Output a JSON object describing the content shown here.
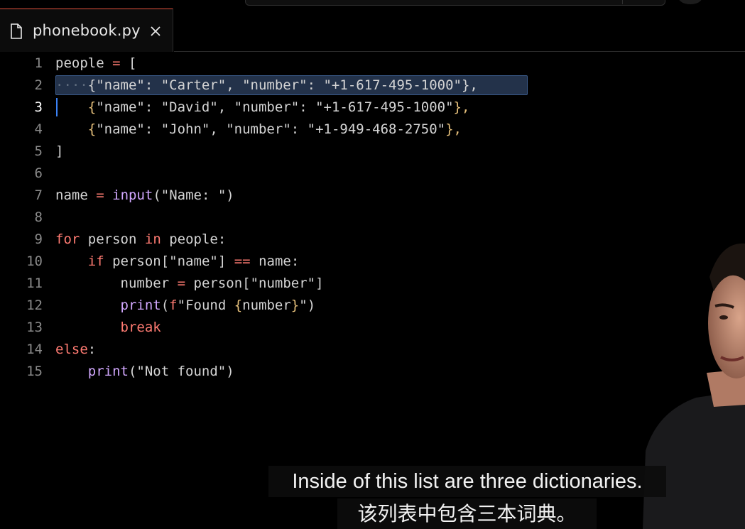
{
  "tab": {
    "filename": "phonebook.py",
    "file_icon": "file-icon",
    "close_icon": "close-icon"
  },
  "editor": {
    "active_line": 3,
    "lines": [
      {
        "num": "1"
      },
      {
        "num": "2"
      },
      {
        "num": "3"
      },
      {
        "num": "4"
      },
      {
        "num": "5"
      },
      {
        "num": "6"
      },
      {
        "num": "7"
      },
      {
        "num": "8"
      },
      {
        "num": "9"
      },
      {
        "num": "10"
      },
      {
        "num": "11"
      },
      {
        "num": "12"
      },
      {
        "num": "13"
      },
      {
        "num": "14"
      },
      {
        "num": "15"
      }
    ],
    "code": {
      "l1_var": "people",
      "l1_op": "=",
      "l1_bracket": "[",
      "l2_text": "{\"name\": \"Carter\", \"number\": \"+1-617-495-1000\"},",
      "l3_open": "{",
      "l3_text": "\"name\": \"David\", \"number\": \"+1-617-495-1000\"",
      "l3_close": "},",
      "l4_open": "{",
      "l4_text": "\"name\": \"John\", \"number\": \"+1-949-468-2750\"",
      "l4_close": "},",
      "l5_bracket": "]",
      "l7_var": "name",
      "l7_op": "=",
      "l7_fn": "input",
      "l7_args": "(\"Name: \")",
      "l9_for": "for",
      "l9_var": "person",
      "l9_in": "in",
      "l9_iter": "people:",
      "l10_if": "if",
      "l10_expr": "person[\"name\"]",
      "l10_op": "==",
      "l10_rhs": "name:",
      "l11_var": "number",
      "l11_op": "=",
      "l11_rhs": "person[\"number\"]",
      "l12_fn": "print",
      "l12_open": "(",
      "l12_f": "f",
      "l12_str1": "\"Found ",
      "l12_brace_open": "{",
      "l12_var": "number",
      "l12_brace_close": "}",
      "l12_str2": "\")",
      "l13_break": "break",
      "l14_else": "else",
      "l14_colon": ":",
      "l15_fn": "print",
      "l15_args": "(\"Not found\")"
    }
  },
  "subtitles": {
    "english": "Inside of this list are three dictionaries.",
    "chinese": "该列表中包含三本词典。"
  },
  "colors": {
    "background": "#000000",
    "keyword": "#ff7b72",
    "function": "#d2a8ff",
    "selection": "#23324a",
    "cursor": "#3b82f6",
    "tab_accent": "#e5533d"
  }
}
